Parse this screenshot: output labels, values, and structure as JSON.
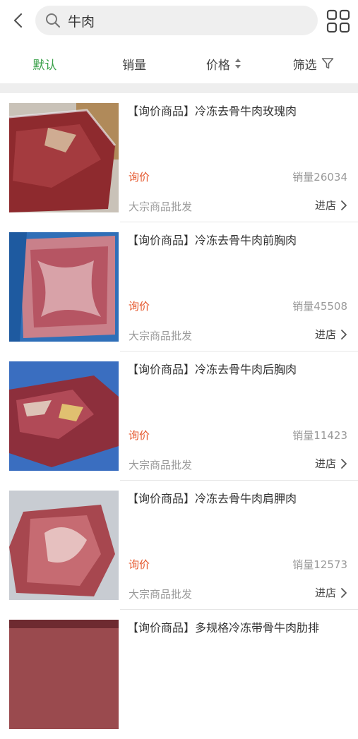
{
  "search": {
    "query": "牛肉"
  },
  "sort_tabs": [
    {
      "label": "默认",
      "active": true
    },
    {
      "label": "销量",
      "active": false
    },
    {
      "label": "价格",
      "active": false
    },
    {
      "label": "筛选",
      "active": false
    }
  ],
  "products": [
    {
      "title": "【询价商品】冷冻去骨牛肉玫瑰肉",
      "price": "询价",
      "sales": "销量26034",
      "tag": "大宗商品批发",
      "shop": "进店"
    },
    {
      "title": "【询价商品】冷冻去骨牛肉前胸肉",
      "price": "询价",
      "sales": "销量45508",
      "tag": "大宗商品批发",
      "shop": "进店"
    },
    {
      "title": "【询价商品】冷冻去骨牛肉后胸肉",
      "price": "询价",
      "sales": "销量11423",
      "tag": "大宗商品批发",
      "shop": "进店"
    },
    {
      "title": "【询价商品】冷冻去骨牛肉肩胛肉",
      "price": "询价",
      "sales": "销量12573",
      "tag": "大宗商品批发",
      "shop": "进店"
    },
    {
      "title": "【询价商品】多规格冷冻带骨牛肉肋排",
      "price": "",
      "sales": "",
      "tag": "",
      "shop": ""
    }
  ],
  "colors": {
    "active": "#3aa14a",
    "price": "#e5562b"
  },
  "icons": {
    "back": "chevron-left-icon",
    "search": "search-icon",
    "grid": "grid-view-icon",
    "sort": "sort-updown-icon",
    "filter": "filter-funnel-icon",
    "shop": "chevron-right-icon"
  }
}
